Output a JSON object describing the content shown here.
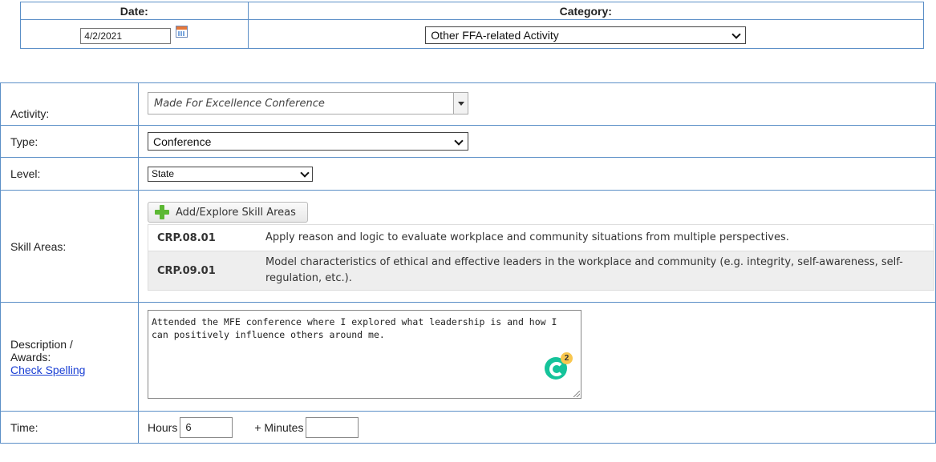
{
  "top": {
    "date_label": "Date:",
    "category_label": "Category:",
    "date_value": "4/2/2021",
    "category_value": "Other FFA-related Activity"
  },
  "form": {
    "activity_label": "Activity:",
    "activity_value": "Made For Excellence Conference",
    "type_label": "Type:",
    "type_value": "Conference",
    "level_label": "Level:",
    "level_value": "State",
    "skill_label": "Skill Areas:",
    "add_skill_label": "Add/Explore Skill Areas",
    "skills": [
      {
        "code": "CRP.08.01",
        "desc": "Apply reason and logic to evaluate workplace and community situations from multiple perspectives."
      },
      {
        "code": "CRP.09.01",
        "desc": "Model characteristics of ethical and effective leaders in the workplace and community (e.g. integrity, self-awareness, self-regulation, etc.)."
      }
    ],
    "desc_label_1": "Description /",
    "desc_label_2": "Awards:",
    "check_spelling": "Check Spelling",
    "desc_value": "Attended the MFE conference where I explored what leadership is and how I can positively influence others around me.",
    "grammarly_count": "2",
    "time_label": "Time:",
    "hours_label": "Hours",
    "hours_value": "6",
    "minutes_label": "+ Minutes",
    "minutes_value": ""
  },
  "colors": {
    "border": "#5b8fc7",
    "link": "#1a3fd4",
    "plus_icon": "#5cb833",
    "grammarly": "#15c39a"
  }
}
